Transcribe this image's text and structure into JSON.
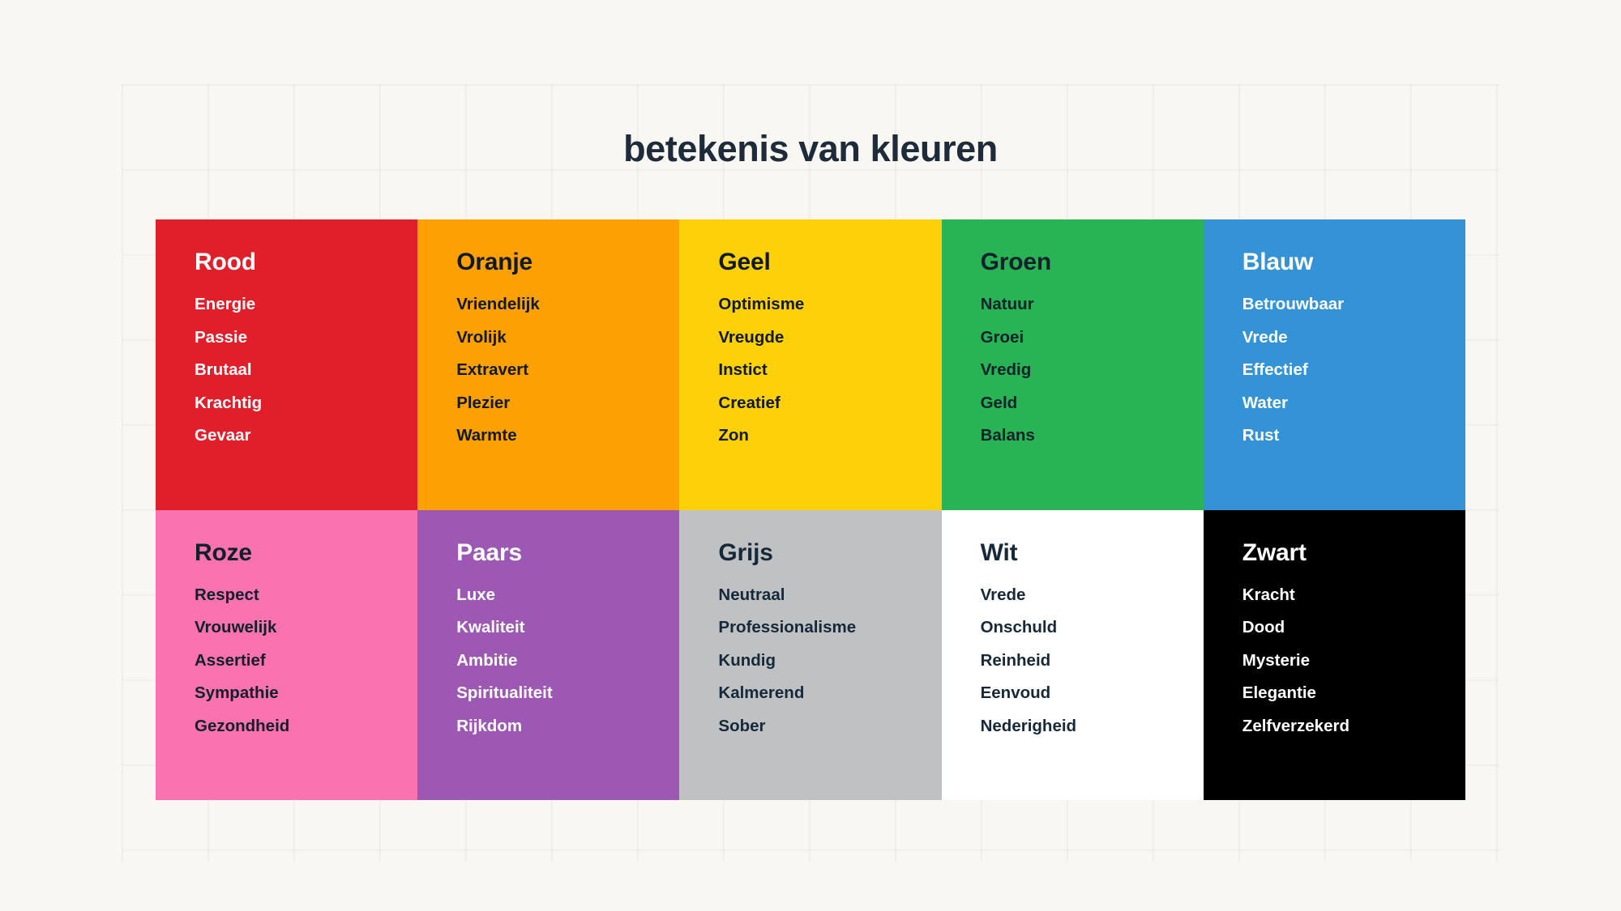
{
  "page": {
    "title": "betekenis van kleuren",
    "background_color": "#f8f7f2",
    "title_color": "#1d2b3a"
  },
  "chart_data": {
    "type": "table",
    "title": "betekenis van kleuren",
    "layout": {
      "rows": 2,
      "columns": 5
    },
    "categories": [
      "Rood",
      "Oranje",
      "Geel",
      "Groen",
      "Blauw",
      "Roze",
      "Paars",
      "Grijs",
      "Wit",
      "Zwart"
    ]
  },
  "cells": [
    {
      "name": "Rood",
      "bg": "#e01f2b",
      "fg": "#ffffff",
      "items": [
        "Energie",
        "Passie",
        "Brutaal",
        "Krachtig",
        "Gevaar"
      ]
    },
    {
      "name": "Oranje",
      "bg": "#fca003",
      "fg": "#0f1a24",
      "items": [
        "Vriendelijk",
        "Vrolijk",
        "Extravert",
        "Plezier",
        "Warmte"
      ]
    },
    {
      "name": "Geel",
      "bg": "#fdd008",
      "fg": "#0f1a24",
      "items": [
        "Optimisme",
        "Vreugde",
        "Instict",
        "Creatief",
        "Zon"
      ]
    },
    {
      "name": "Groen",
      "bg": "#28b355",
      "fg": "#10202c",
      "items": [
        "Natuur",
        "Groei",
        "Vredig",
        "Geld",
        "Balans"
      ]
    },
    {
      "name": "Blauw",
      "bg": "#3393d6",
      "fg": "#ffffff",
      "items": [
        "Betrouwbaar",
        "Vrede",
        "Effectief",
        "Water",
        "Rust"
      ]
    },
    {
      "name": "Roze",
      "bg": "#fa72ae",
      "fg": "#10202c",
      "items": [
        "Respect",
        "Vrouwelijk",
        "Assertief",
        "Sympathie",
        "Gezondheid"
      ]
    },
    {
      "name": "Paars",
      "bg": "#9c58b3",
      "fg": "#ffffff",
      "items": [
        "Luxe",
        "Kwaliteit",
        "Ambitie",
        "Spiritualiteit",
        "Rijkdom"
      ]
    },
    {
      "name": "Grijs",
      "bg": "#bfc1c3",
      "fg": "#16293a",
      "items": [
        "Neutraal",
        "Professionalisme",
        "Kundig",
        "Kalmerend",
        "Sober"
      ]
    },
    {
      "name": "Wit",
      "bg": "#ffffff",
      "fg": "#16293a",
      "items": [
        "Vrede",
        "Onschuld",
        "Reinheid",
        "Eenvoud",
        "Nederigheid"
      ]
    },
    {
      "name": "Zwart",
      "bg": "#000000",
      "fg": "#ffffff",
      "items": [
        "Kracht",
        "Dood",
        "Mysterie",
        "Elegantie",
        "Zelfverzekerd"
      ]
    }
  ]
}
